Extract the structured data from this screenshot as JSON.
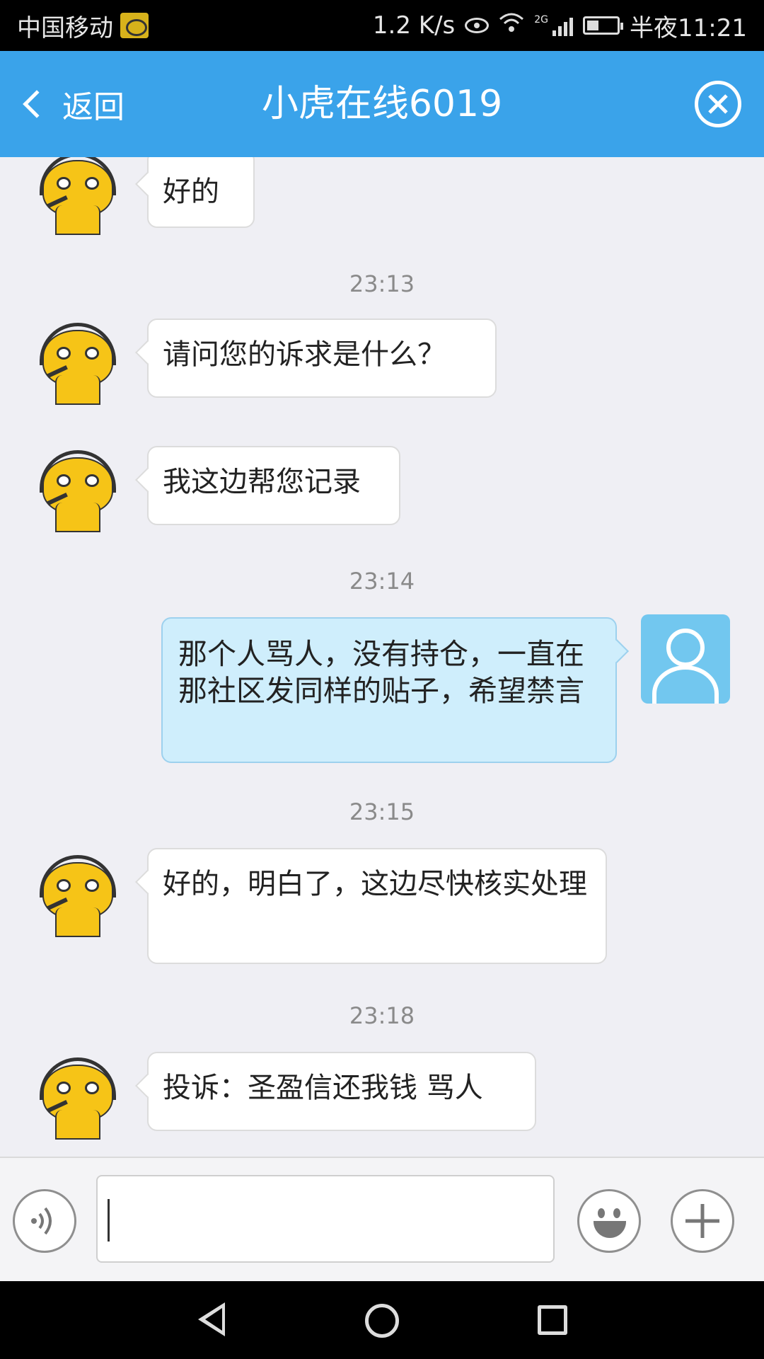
{
  "status_bar": {
    "carrier": "中国移动",
    "net_speed": "1.2 K/s",
    "network_type": "2G",
    "time": "半夜11:21",
    "icons": [
      "carrier-badge-icon",
      "eye-icon",
      "wifi-icon",
      "signal-icon",
      "battery-icon"
    ]
  },
  "header": {
    "back_label": "返回",
    "title": "小虎在线6019",
    "close_icon": "close-circle-icon",
    "background": "#3aa3ea"
  },
  "messages": [
    {
      "from": "agent",
      "text": "好的"
    },
    {
      "time": "23:13"
    },
    {
      "from": "agent",
      "text": "请问您的诉求是什么？"
    },
    {
      "from": "agent",
      "text": "我这边帮您记录"
    },
    {
      "time": "23:14"
    },
    {
      "from": "user",
      "text": "那个人骂人，没有持仓，一直在那社区发同样的贴子，希望禁言"
    },
    {
      "time": "23:15"
    },
    {
      "from": "agent",
      "text": "好的，明白了，这边尽快核实处理"
    },
    {
      "time": "23:18"
    },
    {
      "from": "agent",
      "text": "投诉：圣盈信还我钱 骂人"
    }
  ],
  "input_bar": {
    "value": "",
    "placeholder": "",
    "icons": [
      "voice-icon",
      "emoji-icon",
      "plus-icon"
    ]
  },
  "nav_bar": {
    "icons": [
      "nav-back-icon",
      "nav-home-icon",
      "nav-recent-icon"
    ]
  },
  "colors": {
    "header": "#3aa3ea",
    "user_bubble": "#cfeefc",
    "agent_bubble": "#ffffff",
    "chat_background": "#efeff4"
  }
}
